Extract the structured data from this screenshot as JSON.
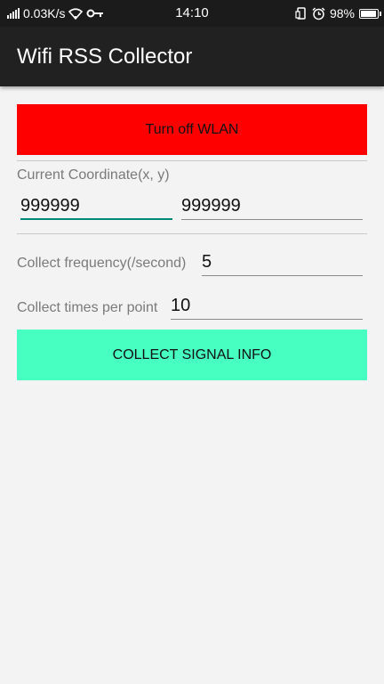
{
  "status_bar": {
    "network_speed": "0.03K/s",
    "time": "14:10",
    "battery": "98%",
    "battery_level": 0.98,
    "icons": [
      "signal-icon",
      "wifi-icon",
      "vpn-key-icon",
      "screen-rotation-icon",
      "alarm-icon",
      "battery-icon"
    ]
  },
  "app_bar": {
    "title": "Wifi RSS Collector",
    "background": "#212121"
  },
  "wlan_button": {
    "label": "Turn off WLAN",
    "color": "#ff0000"
  },
  "coordinate": {
    "label": "Current Coordinate(x, y)",
    "x_value": "999999",
    "y_value": "999999"
  },
  "frequency": {
    "label": "Collect frequency(/second)",
    "value": "5"
  },
  "times": {
    "label": "Collect times per point",
    "value": "10"
  },
  "collect_button": {
    "label": "COLLECT SIGNAL INFO",
    "color": "#46ffc0"
  }
}
